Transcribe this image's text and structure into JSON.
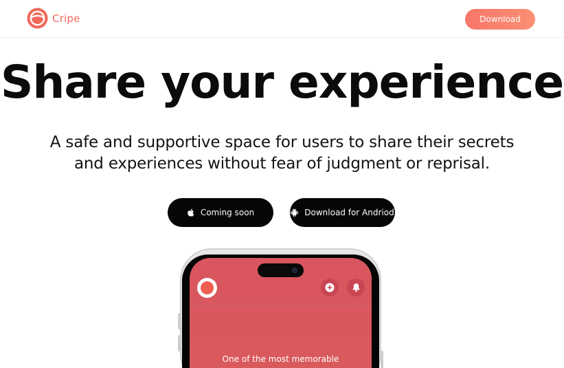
{
  "nav": {
    "brand_name": "Cripe",
    "download_label": "Download"
  },
  "hero": {
    "title": "Share your experience",
    "subtitle_line1": "A safe and supportive space for users to share their secrets",
    "subtitle_line2": "and experiences without fear of judgment or reprisal."
  },
  "store_buttons": {
    "ios_label": "Coming soon",
    "ios_icon": "apple-icon",
    "android_label": "Download for Andriod",
    "android_icon": "android-icon"
  },
  "phone_preview": {
    "post_text": "One of the most memorable"
  },
  "colors": {
    "brand": "#f06a5c",
    "download_gradient_start": "#f7766a",
    "download_gradient_end": "#fb8f73",
    "app_background": "#d9555f",
    "store_button": "#060606"
  }
}
